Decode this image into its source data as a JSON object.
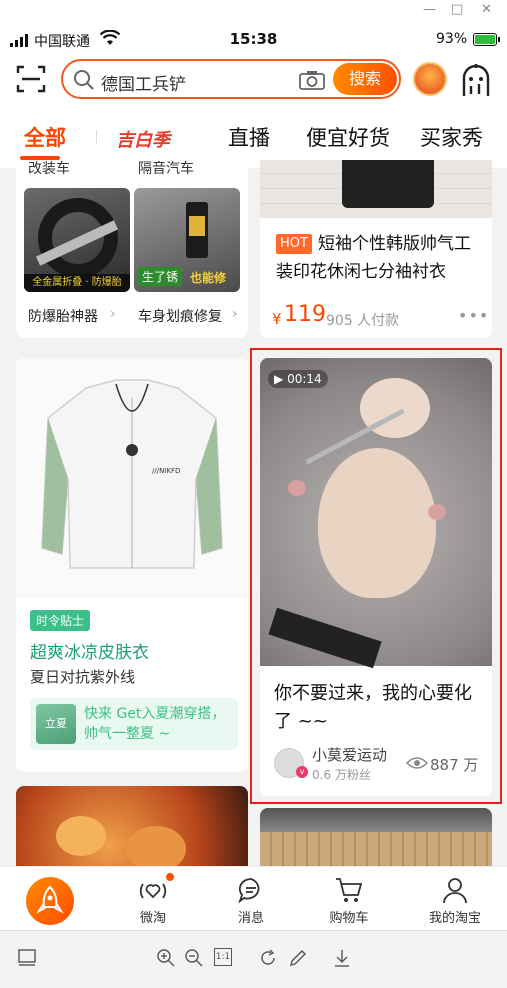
{
  "status_bar": {
    "carrier": "中国联通",
    "time": "15:38",
    "battery": "93%"
  },
  "search": {
    "query": "德国工兵铲",
    "button": "搜索"
  },
  "tabs": [
    "全部",
    "吉白季",
    "直播",
    "便宜好货",
    "买家秀"
  ],
  "left_column": {
    "top_partial_left": "改装车",
    "top_partial_right": "隔音汽车",
    "mini_items": [
      {
        "label": "防爆胎神器",
        "img_caption": "全金属折叠 · 防爆胎"
      },
      {
        "label": "车身划痕修复",
        "img_caption_a": "生了锈",
        "img_caption_b": "也能修"
      }
    ],
    "promo_card": {
      "badge": "时令贴士",
      "title": "超爽冰凉皮肤衣",
      "subtitle": "夏日对抗紫外线",
      "banner_tag": "立夏",
      "banner_text": "快来 Get入夏潮穿搭，帅气一整夏 ~",
      "jacket_brand": "///NIKFD"
    }
  },
  "right_column": {
    "product": {
      "hot": "HOT",
      "title": "短袖个性韩版帅气工装印花休闲七分袖衬衣",
      "price_symbol": "¥",
      "price": "119",
      "sold": "905 人付款"
    },
    "video": {
      "duration": "00:14",
      "title": "你不要过来，我的心要化了 ~~",
      "author": "小莫爱运动",
      "fans": "0.6 万粉丝",
      "views": "887 万",
      "highlight_color": "#e8201a"
    }
  },
  "bottom_nav": [
    "微淘",
    "消息",
    "购物车",
    "我的淘宝"
  ],
  "viewer_zoom_label": "1:1",
  "accent": "#ff5000"
}
